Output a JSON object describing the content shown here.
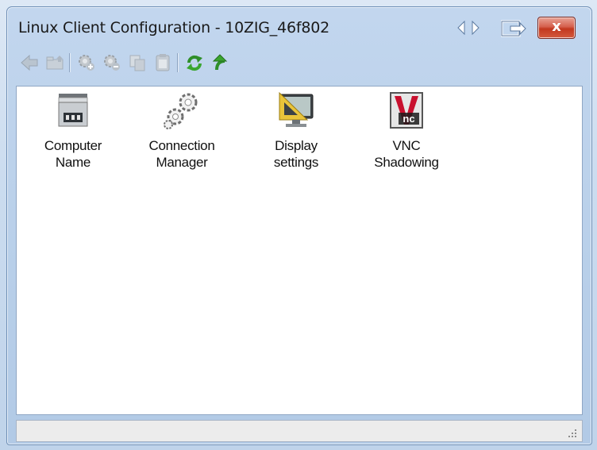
{
  "window": {
    "title": "Linux Client Configuration - 10ZIG_46f802"
  },
  "title_buttons": {
    "close_label": "x"
  },
  "toolbar": {
    "buttons": [
      {
        "icon": "back-arrow-icon",
        "enabled": false
      },
      {
        "icon": "up-folder-icon",
        "enabled": false
      },
      {
        "icon": "add-gear-icon",
        "enabled": false
      },
      {
        "icon": "remove-gear-icon",
        "enabled": false
      },
      {
        "icon": "copy-icon",
        "enabled": false
      },
      {
        "icon": "paste-icon",
        "enabled": false
      },
      {
        "icon": "refresh-green-icon",
        "enabled": true
      },
      {
        "icon": "upload-green-icon",
        "enabled": true
      }
    ]
  },
  "items": [
    {
      "line1": "Computer",
      "line2": "Name",
      "icon": "computer-name-icon"
    },
    {
      "line1": "Connection",
      "line2": "Manager",
      "icon": "connection-manager-gears-icon"
    },
    {
      "line1": "Display",
      "line2": "settings",
      "icon": "display-settings-monitor-icon"
    },
    {
      "line1": "VNC",
      "line2": "Shadowing",
      "icon": "vnc-shadowing-icon"
    }
  ],
  "colors": {
    "window_frame": "#b8cfe9",
    "close_button": "#c2381f",
    "content_bg": "#ffffff"
  }
}
